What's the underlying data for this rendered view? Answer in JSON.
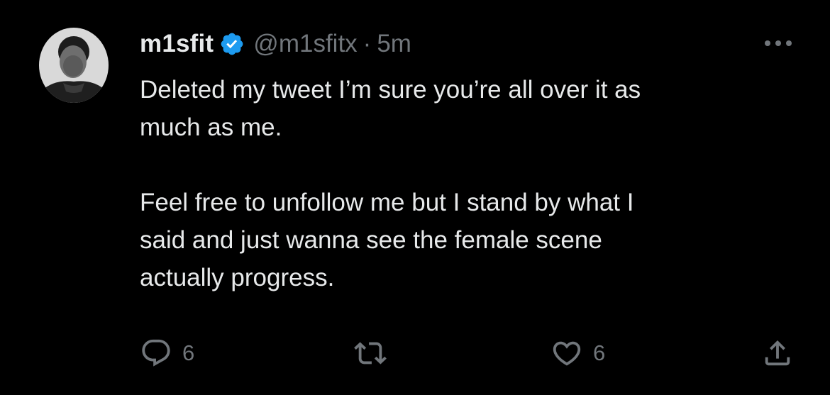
{
  "tweet": {
    "display_name": "m1sfit",
    "handle": "@m1sfitx",
    "separator": "·",
    "time": "5m",
    "body": [
      "Deleted my tweet I’m sure you’re all over it as",
      "much as me.",
      "Feel free to unfollow me but I stand by what I",
      "said and just wanna see the female scene",
      "actually progress."
    ]
  },
  "actions": {
    "reply_count": "6",
    "like_count": "6"
  },
  "icons": {
    "verified": "verified-badge-icon",
    "more": "more-horizontal-icon",
    "reply": "reply-icon",
    "retweet": "retweet-icon",
    "like": "heart-icon",
    "share": "share-icon"
  },
  "colors": {
    "background": "#000000",
    "text": "#e7e9ea",
    "muted": "#71767b",
    "verified": "#1d9bf0"
  }
}
